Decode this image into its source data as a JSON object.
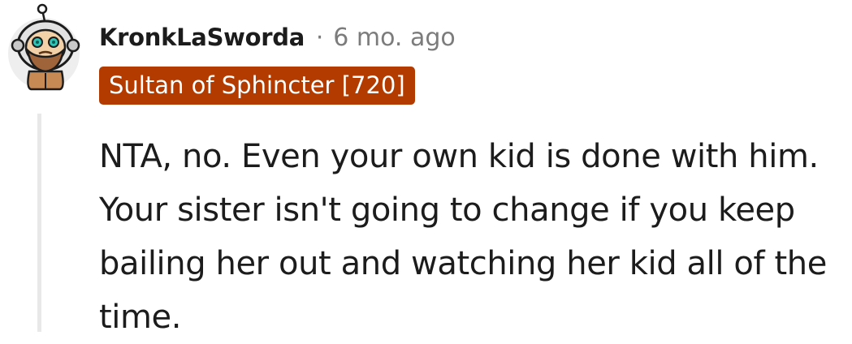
{
  "comment": {
    "author": "KronkLaSworda",
    "separator": "·",
    "timestamp": "6 mo. ago",
    "flair": "Sultan of Sphincter [720]",
    "body": "NTA, no. Even your own kid is done with him. Your sister isn't going to change if you keep bailing her out and watching her kid all of the time.",
    "avatar_icon": "snoo-astronaut-avatar"
  },
  "colors": {
    "flair_background": "#b33b00",
    "flair_text": "#ffffff",
    "username": "#1c1c1c",
    "meta_text": "#7c7c7c",
    "thread_line": "#e8e8e8"
  }
}
